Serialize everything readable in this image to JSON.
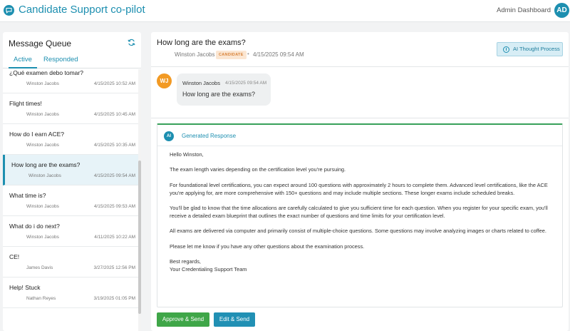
{
  "header": {
    "logo_icon": "chat-bubble-icon",
    "title": "Candidate Support co-pilot",
    "admin_link": "Admin Dashboard",
    "avatar_initials": "AD",
    "brand_color": "#1d8fb0"
  },
  "sidebar": {
    "title": "Message Queue",
    "refresh_icon": "refresh-icon",
    "tabs": [
      {
        "label": "Active",
        "active": true
      },
      {
        "label": "Responded",
        "active": false
      }
    ],
    "messages": [
      {
        "question": "¿Qué examen debo tomar?",
        "name": "Winston Jacobs",
        "date": "4/15/2025 10:52 AM",
        "selected": false
      },
      {
        "question": "Flight times!",
        "name": "Winston Jacobs",
        "date": "4/15/2025 10:45 AM",
        "selected": false
      },
      {
        "question": "How do I earn ACE?",
        "name": "Winston Jacobs",
        "date": "4/15/2025 10:35 AM",
        "selected": false
      },
      {
        "question": "How long are the exams?",
        "name": "Winston Jacobs",
        "date": "4/15/2025 09:54 AM",
        "selected": true
      },
      {
        "question": "What time is?",
        "name": "Winston Jacobs",
        "date": "4/15/2025 09:53 AM",
        "selected": false
      },
      {
        "question": "What do i do next?",
        "name": "Winston Jacobs",
        "date": "4/11/2025 10:22 AM",
        "selected": false
      },
      {
        "question": "CE!",
        "name": "James Davis",
        "date": "3/27/2025 12:56 PM",
        "selected": false
      },
      {
        "question": "Help! Stuck",
        "name": "Nathan Reyes",
        "date": "3/19/2025 01:05 PM",
        "selected": false
      }
    ]
  },
  "conversation": {
    "title": "How long are the exams?",
    "author": "Winston Jacobs",
    "badge": "CANDIDATE",
    "separator": "•",
    "date": "4/15/2025 09:54 AM",
    "ai_thought_label": "AI Thought Process",
    "message": {
      "avatar_initials": "WJ",
      "avatar_color": "#f29a24",
      "sender": "Winston Jacobs",
      "time": "4/15/2025 09:54 AM",
      "text": "How long are the exams?"
    }
  },
  "response": {
    "ai_badge": "AI",
    "label": "Generated Response",
    "accent_color": "#38a05a",
    "paragraphs": [
      "Hello Winston,",
      "The exam length varies depending on the certification level you're pursuing.",
      "For foundational level certifications, you can expect around 100 questions with approximately 2 hours to complete them. Advanced level certifications, like the ACE you're applying for, are more comprehensive with 150+ questions and may include multiple sections. These longer exams include scheduled breaks.",
      "You'll be glad to know that the time allocations are carefully calculated to give you sufficient time for each question. When you register for your specific exam, you'll receive a detailed exam blueprint that outlines the exact number of questions and time limits for your certification level.",
      "All exams are delivered via computer and primarily consist of multiple-choice questions. Some questions may involve analyzing images or charts related to coffee.",
      "Please let me know if you have any other questions about the examination process."
    ],
    "closing": "Best regards,",
    "signature": "Your Credentialing Support Team"
  },
  "actions": {
    "approve_label": "Approve & Send",
    "approve_color": "#3fa648",
    "edit_label": "Edit & Send",
    "edit_color": "#2190b4"
  }
}
